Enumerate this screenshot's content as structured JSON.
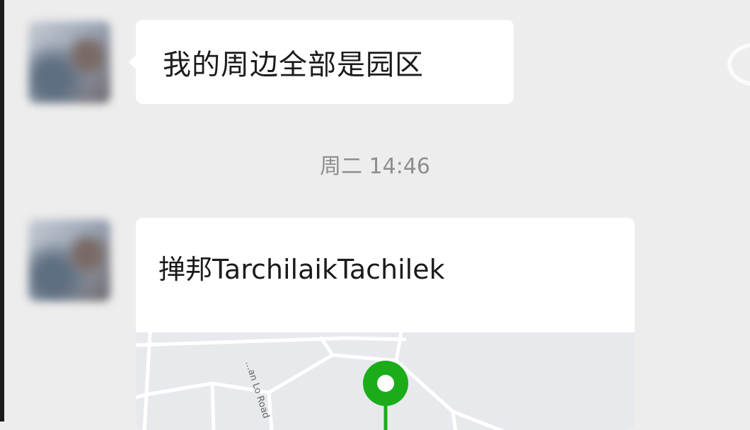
{
  "chat": {
    "messages": [
      {
        "type": "text",
        "text": "我的周边全部是园区"
      },
      {
        "type": "timestamp",
        "text": "周二 14:46"
      },
      {
        "type": "location",
        "title": "掸邦TarchilaikTachilek",
        "map": {
          "road_label": "...an Lo Road",
          "pin_color": "#1aad19"
        }
      }
    ]
  },
  "colors": {
    "background": "#ededed",
    "bubble": "#ffffff",
    "timestamp_text": "#8d8d8d",
    "map_bg": "#e7e9ec",
    "map_roads": "#ffffff",
    "pin": "#1aad19"
  }
}
